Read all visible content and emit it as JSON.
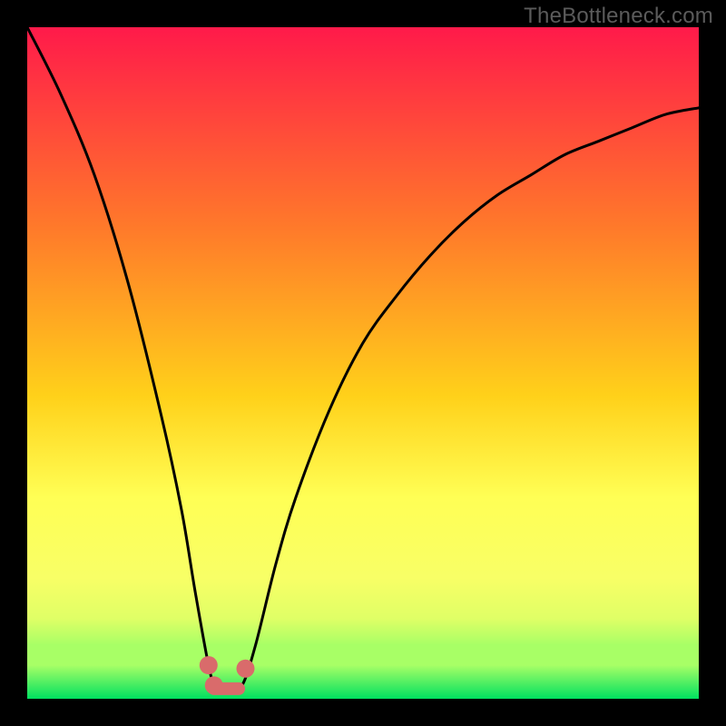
{
  "watermark": "TheBottleneck.com",
  "colors": {
    "page_bg": "#000000",
    "gradient_top": "#ff1a4a",
    "gradient_mid1": "#ff7a2a",
    "gradient_mid2": "#ffd11a",
    "gradient_mid3": "#ffff55",
    "gradient_band1": "#f8ff66",
    "gradient_band2": "#e0ff66",
    "gradient_band3": "#a8ff66",
    "gradient_bottom": "#00e060",
    "curve": "#000000",
    "weights": "#d96b6b"
  },
  "chart_data": {
    "type": "line",
    "title": "",
    "xlabel": "",
    "ylabel": "",
    "xlim": [
      0,
      100
    ],
    "ylim": [
      0,
      100
    ],
    "annotations": [
      {
        "text": "TheBottleneck.com",
        "position": "top-right"
      }
    ],
    "series": [
      {
        "name": "bottleneck-curve",
        "x": [
          0,
          5,
          10,
          15,
          20,
          23,
          25,
          27,
          28,
          30,
          32,
          34,
          37,
          40,
          45,
          50,
          55,
          60,
          65,
          70,
          75,
          80,
          85,
          90,
          95,
          100
        ],
        "y": [
          100,
          90,
          78,
          62,
          42,
          28,
          16,
          5,
          2,
          1,
          2,
          8,
          20,
          30,
          43,
          53,
          60,
          66,
          71,
          75,
          78,
          81,
          83,
          85,
          87,
          88
        ]
      }
    ],
    "markers": [
      {
        "name": "weight-left-upper",
        "x": 27.0,
        "y": 5.0
      },
      {
        "name": "weight-left-lower",
        "x": 27.8,
        "y": 2.0
      },
      {
        "name": "weight-right",
        "x": 32.5,
        "y": 4.5
      }
    ],
    "connector": {
      "name": "weight-bar",
      "from": {
        "x": 27.8,
        "y": 1.5
      },
      "to": {
        "x": 31.5,
        "y": 1.5
      }
    },
    "gradient_stops_pct": [
      0,
      30,
      55,
      70,
      82,
      88,
      92,
      95,
      100
    ]
  }
}
